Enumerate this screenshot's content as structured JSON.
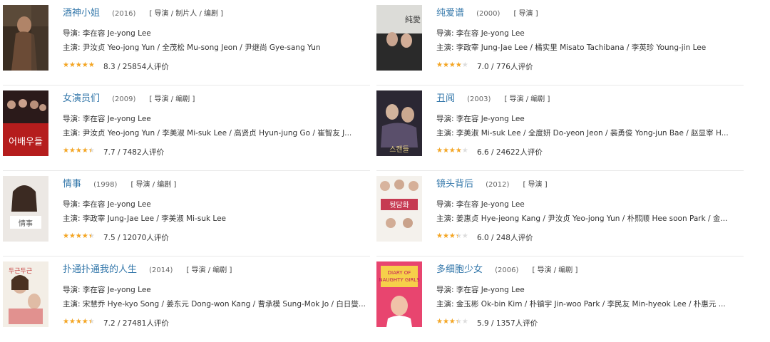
{
  "labels": {
    "director": "导演",
    "cast": "主演",
    "sep": ":"
  },
  "films": [
    {
      "title": "酒神小姐",
      "year": "(2016)",
      "roles": "[ 导演 / 制片人 / 编剧 ]",
      "director_line": "导演: 李在容 Je-yong Lee",
      "cast_line": "主演: 尹汝贞 Yeo-jong Yun / 全茂松 Mu-song Jeon / 尹继尚 Gye-sang Yun",
      "rating_text": "8.3 / 25854人评价",
      "stars": 4.5,
      "poster": "poster-1"
    },
    {
      "title": "纯爱谱",
      "year": "(2000)",
      "roles": "[ 导演 ]",
      "director_line": "导演: 李在容 Je-yong Lee",
      "cast_line": "主演: 李政宰 Jung-Jae Lee / 橘实里 Misato Tachibana / 李英珍 Young-jin Lee",
      "rating_text": "7.0 / 776人评价",
      "stars": 3.5,
      "poster": "poster-2"
    },
    {
      "title": "女演员们",
      "year": "(2009)",
      "roles": "[ 导演 / 编剧 ]",
      "director_line": "导演: 李在容 Je-yong Lee",
      "cast_line": "主演: 尹汝贞 Yeo-jong Yun / 李美淑 Mi-suk Lee / 高贤贞 Hyun-jung Go / 崔智友 J...",
      "rating_text": "7.7 / 7482人评价",
      "stars": 4,
      "poster": "poster-3"
    },
    {
      "title": "丑闻",
      "year": "(2003)",
      "roles": "[ 导演 / 编剧 ]",
      "director_line": "导演: 李在容 Je-yong Lee",
      "cast_line": "主演: 李美淑 Mi-suk Lee / 全度妍 Do-yeon Jeon / 裴勇俊 Yong-jun Bae / 赵显宰 H...",
      "rating_text": "6.6 / 24622人评价",
      "stars": 3.5,
      "poster": "poster-4"
    },
    {
      "title": "情事",
      "year": "(1998)",
      "roles": "[ 导演 / 编剧 ]",
      "director_line": "导演: 李在容 Je-yong Lee",
      "cast_line": "主演: 李政宰 Jung-Jae Lee / 李美淑 Mi-suk Lee",
      "rating_text": "7.5 / 12070人评价",
      "stars": 4,
      "poster": "poster-5"
    },
    {
      "title": "镜头背后",
      "year": "(2012)",
      "roles": "[ 导演 ]",
      "director_line": "导演: 李在容 Je-yong Lee",
      "cast_line": "主演: 姜惠贞 Hye-jeong Kang / 尹汝贞 Yeo-jong Yun / 朴熙顺 Hee soon Park / 金...",
      "rating_text": "6.0 / 248人评价",
      "stars": 3,
      "poster": "poster-6"
    },
    {
      "title": "扑通扑通我的人生",
      "year": "(2014)",
      "roles": "[ 导演 / 编剧 ]",
      "director_line": "导演: 李在容 Je-yong Lee",
      "cast_line": "主演: 宋慧乔 Hye-kyo Song / 姜东元 Dong-won Kang / 曹承模 Sung-Mok Jo / 白日燮...",
      "rating_text": "7.2 / 27481人评价",
      "stars": 4,
      "poster": "poster-7"
    },
    {
      "title": "多细胞少女",
      "year": "(2006)",
      "roles": "[ 导演 / 编剧 ]",
      "director_line": "导演: 李在容 Je-yong Lee",
      "cast_line": "主演: 金玉彬 Ok-bin Kim / 朴镇宇 Jin-woo Park / 李民友 Min-hyeok Lee / 朴惠元 ...",
      "rating_text": "5.9 / 1357人评价",
      "stars": 3,
      "poster": "poster-8"
    }
  ],
  "colors": {
    "title": "#3377aa",
    "star_full": "#f5a623",
    "star_empty": "#dddddd"
  },
  "star_glyph": "★★★★★"
}
